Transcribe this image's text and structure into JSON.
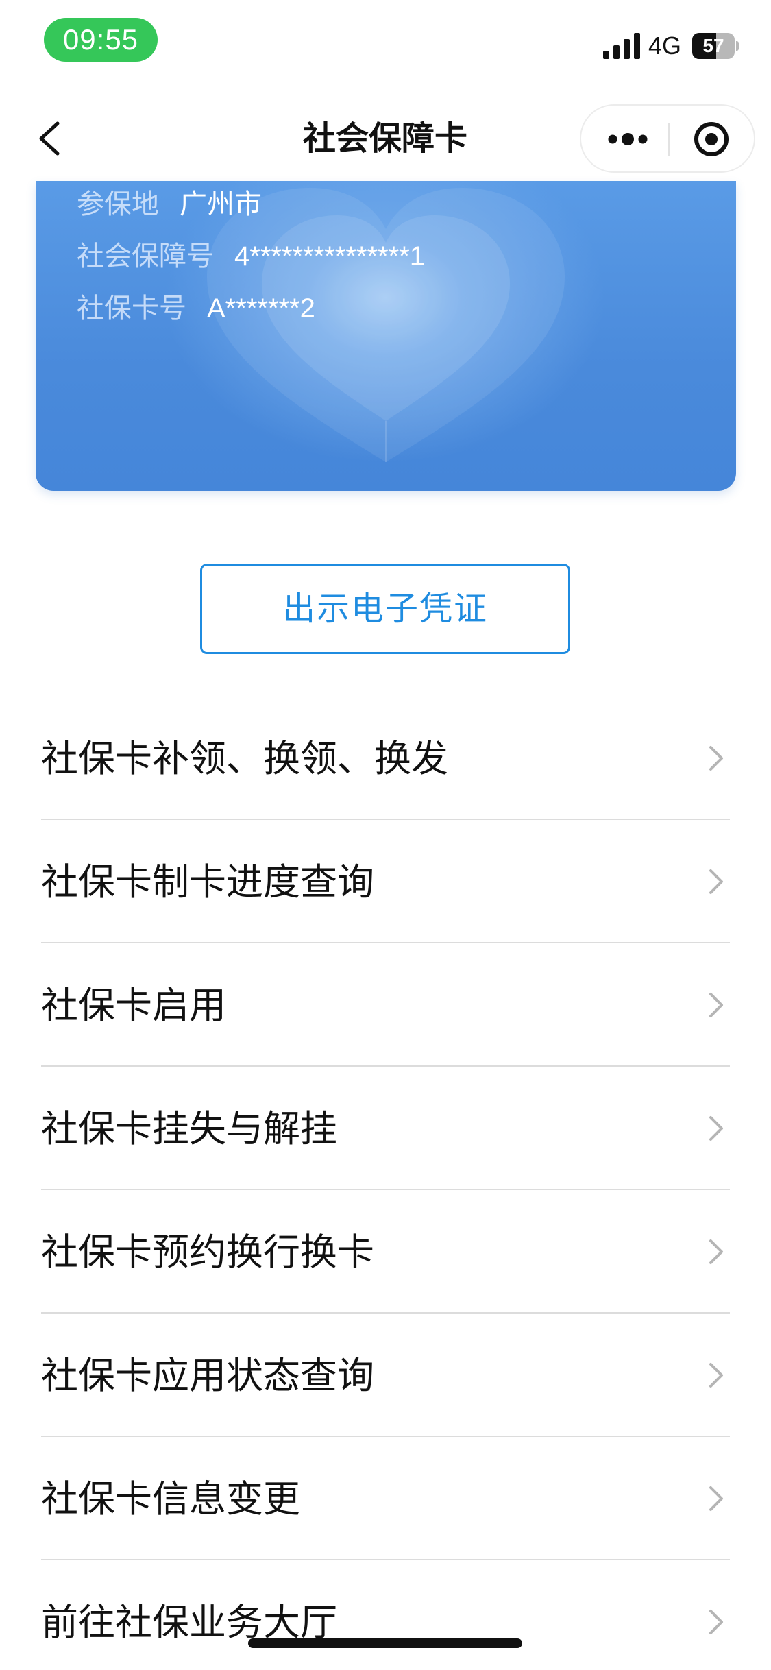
{
  "status_bar": {
    "time": "09:55",
    "network": "4G",
    "battery_level": "57",
    "battery_percent": 57,
    "time_pill_color": "#35c759"
  },
  "nav": {
    "title": "社会保障卡",
    "back_icon": "chevron-left-icon",
    "more_icon": "more-dots-icon",
    "close_icon": "target-circle-icon"
  },
  "card": {
    "rows": [
      {
        "label": "参保地",
        "value": "广州市"
      },
      {
        "label": "社会保障号",
        "value": "4***************1"
      },
      {
        "label": "社保卡号",
        "value": "A*******2"
      }
    ],
    "accent_color": "#4a8adb"
  },
  "voucher_button": {
    "label": "出示电子凭证",
    "color": "#1f8ce0"
  },
  "menu": {
    "items": [
      {
        "label": "社保卡补领、换领、换发"
      },
      {
        "label": "社保卡制卡进度查询"
      },
      {
        "label": "社保卡启用"
      },
      {
        "label": "社保卡挂失与解挂"
      },
      {
        "label": "社保卡预约换行换卡"
      },
      {
        "label": "社保卡应用状态查询"
      },
      {
        "label": "社保卡信息变更"
      },
      {
        "label": "前往社保业务大厅"
      }
    ],
    "chevron_icon": "chevron-right-icon"
  }
}
